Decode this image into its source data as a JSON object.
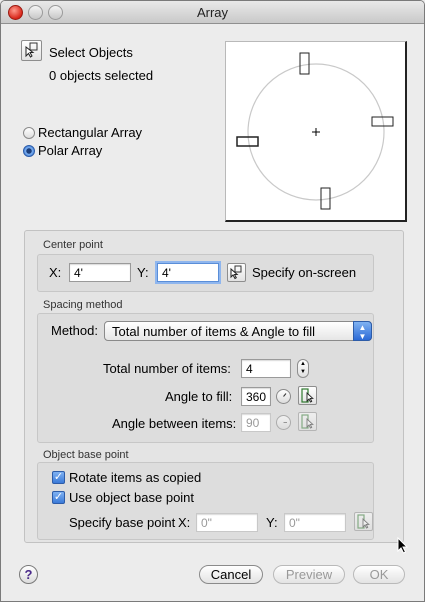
{
  "window": {
    "title": "Array"
  },
  "select_objects": {
    "label": "Select Objects",
    "count_text": "0 objects selected"
  },
  "array_type": {
    "options": [
      "Rectangular Array",
      "Polar Array"
    ],
    "selected": "Polar Array"
  },
  "center_point": {
    "title": "Center point",
    "x_label": "X:",
    "x_value": "4'",
    "y_label": "Y:",
    "y_value": "4'",
    "specify_label": "Specify on-screen"
  },
  "spacing_method": {
    "title": "Spacing method",
    "method_label": "Method:",
    "method_value": "Total number of items & Angle to fill",
    "total_items_label": "Total number of items:",
    "total_items_value": "4",
    "angle_fill_label": "Angle to fill:",
    "angle_fill_value": "360",
    "angle_between_label": "Angle between items:",
    "angle_between_value": "90"
  },
  "object_base_point": {
    "title": "Object base point",
    "rotate_label": "Rotate items as copied",
    "rotate_checked": true,
    "use_base_label": "Use object base point",
    "use_base_checked": true,
    "specify_label": "Specify base point",
    "x_label": "X:",
    "x_value": "0\"",
    "y_label": "Y:",
    "y_value": "0\""
  },
  "buttons": {
    "help": "?",
    "cancel": "Cancel",
    "preview": "Preview",
    "ok": "OK"
  },
  "icons": {
    "select_objects": "select-objects-icon",
    "pick_point": "pick-point-icon",
    "pick_angle": "pick-angle-icon",
    "stepper": "stepper-arrows-icon",
    "angle_dial": "angle-dial-icon"
  },
  "colors": {
    "accent": "#3b7ad8",
    "focus": "#8fb6ee",
    "help_glyph": "#4a2a8a"
  }
}
